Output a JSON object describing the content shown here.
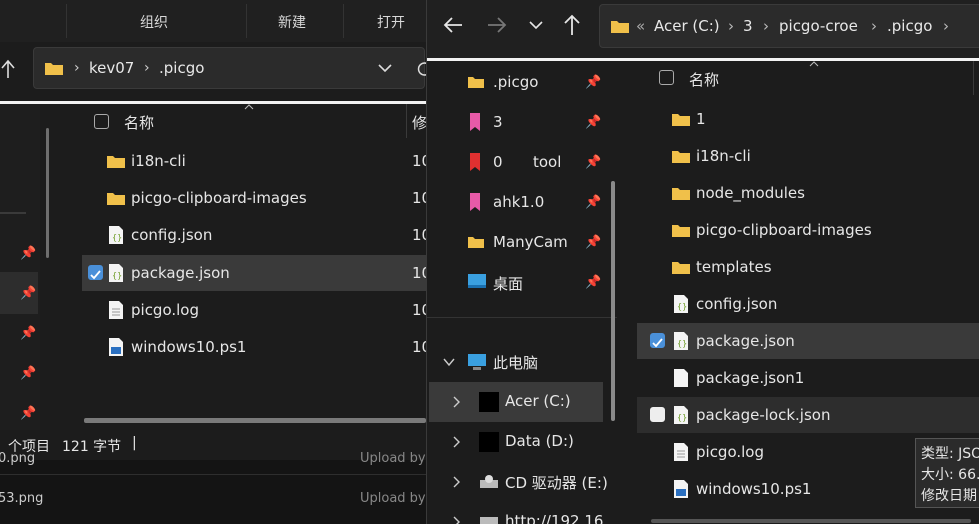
{
  "left_window": {
    "toolbar": {
      "organize": "组织",
      "new": "新建",
      "open": "打开"
    },
    "address": {
      "crumbs": [
        "kev07",
        ".picgo"
      ]
    },
    "header": {
      "name": "名称",
      "modified": "修"
    },
    "files": [
      {
        "name": "i18n-cli",
        "type": "folder",
        "date": "10"
      },
      {
        "name": "picgo-clipboard-images",
        "type": "folder",
        "date": "10"
      },
      {
        "name": "config.json",
        "type": "json",
        "date": "10"
      },
      {
        "name": "package.json",
        "type": "json",
        "date": "10",
        "selected": true
      },
      {
        "name": "picgo.log",
        "type": "log",
        "date": "10"
      },
      {
        "name": "windows10.ps1",
        "type": "ps1",
        "date": "10"
      }
    ],
    "status": {
      "count": "个项目",
      "size": "121 字节",
      "divider": "|"
    },
    "upload_rows": [
      {
        "file": "0.png",
        "action": "Upload by"
      },
      {
        "file": "53.png",
        "action": "Upload by"
      }
    ]
  },
  "right_window": {
    "address": {
      "overflow": "«",
      "crumbs": [
        "Acer (C:)",
        "3",
        "picgo-croe",
        ".picgo"
      ]
    },
    "header": {
      "name": "名称"
    },
    "quick_access": [
      {
        "label": ".picgo",
        "color": "#f0c04a"
      },
      {
        "label": "3",
        "color": "#e85aa8"
      },
      {
        "label": "0",
        "label2": "tool",
        "color": "#e03030"
      },
      {
        "label": "ahk1.0",
        "color": "#e85aa8"
      },
      {
        "label": "ManyCam",
        "color": "#f0c04a"
      },
      {
        "label": "桌面",
        "color": "#3aa0e0"
      }
    ],
    "this_pc": "此电脑",
    "drives": [
      {
        "label": "Acer (C:)"
      },
      {
        "label": "Data (D:)"
      },
      {
        "label": "CD 驱动器 (E:)"
      },
      {
        "label": "http://192.16"
      }
    ],
    "files": [
      {
        "name": "1",
        "type": "folder"
      },
      {
        "name": "i18n-cli",
        "type": "folder"
      },
      {
        "name": "node_modules",
        "type": "folder"
      },
      {
        "name": "picgo-clipboard-images",
        "type": "folder"
      },
      {
        "name": "templates",
        "type": "folder"
      },
      {
        "name": "config.json",
        "type": "json"
      },
      {
        "name": "package.json",
        "type": "json",
        "selected": true
      },
      {
        "name": "package.json1",
        "type": "file"
      },
      {
        "name": "package-lock.json",
        "type": "json",
        "hover": true
      },
      {
        "name": "picgo.log",
        "type": "log"
      },
      {
        "name": "windows10.ps1",
        "type": "ps1"
      }
    ],
    "tooltip": {
      "type": "类型: JSO",
      "size": "大小: 66.",
      "modified": "修改日期"
    }
  }
}
